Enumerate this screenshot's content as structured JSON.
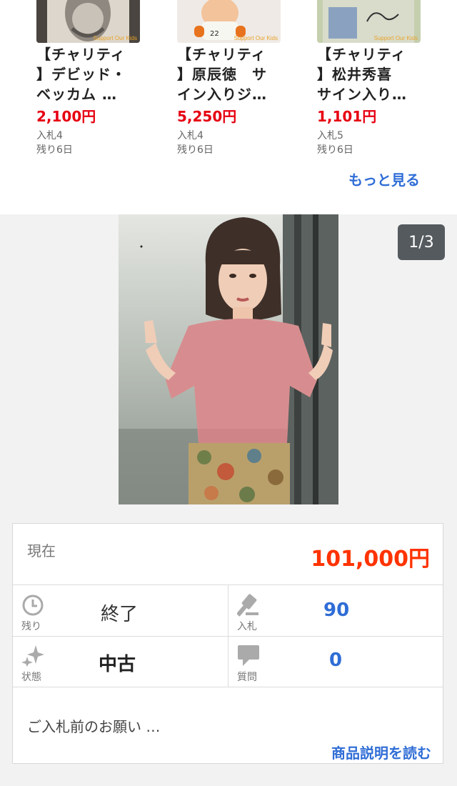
{
  "related": {
    "items": [
      {
        "title_line1": "【チャリティ",
        "title_line2": "】デビッド・",
        "title_line3": "ベッカム …",
        "price": "2,100円",
        "bids": "入札4",
        "remaining": "残り6日",
        "watermark": "Support Our Kids"
      },
      {
        "title_line1": "【チャリティ",
        "title_line2": "】原辰徳　サ",
        "title_line3": "イン入りジ…",
        "price": "5,250円",
        "bids": "入札4",
        "remaining": "残り6日",
        "watermark": "Support Our Kids"
      },
      {
        "title_line1": "【チャリティ",
        "title_line2": "】松井秀喜",
        "title_line3": "サイン入り…",
        "price": "1,101円",
        "bids": "入札5",
        "remaining": "残り6日",
        "watermark": "Support Our Kids"
      }
    ],
    "more_label": "もっと見る"
  },
  "photo": {
    "counter": "1/3"
  },
  "auction": {
    "current_label": "現在",
    "current_price": "101,000円",
    "remaining_caption": "残り",
    "remaining_value": "終了",
    "bids_caption": "入札",
    "bids_value": "90",
    "condition_caption": "状態",
    "condition_value": "中古",
    "questions_caption": "質問",
    "questions_value": "0",
    "notice": "ご入札前のお願い …",
    "read_description": "商品説明を読む"
  },
  "colors": {
    "price_red": "#e60012",
    "current_price": "#ff3300",
    "link_blue": "#2f6dd6"
  },
  "icons": {
    "remaining": "clock-icon",
    "bids": "gavel-icon",
    "condition": "sparkle-icon",
    "questions": "speech-bubble-icon"
  }
}
